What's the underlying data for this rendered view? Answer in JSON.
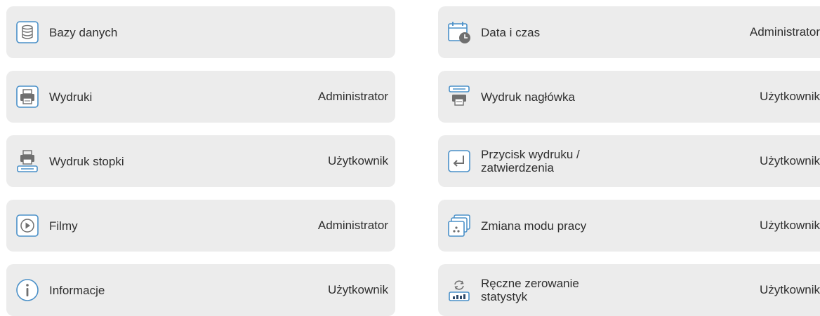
{
  "settings_menu": {
    "items": [
      {
        "label": "Bazy danych",
        "role": "",
        "icon": "database-icon"
      },
      {
        "label": "Data i czas",
        "role": "Administrator",
        "icon": "calendar-clock-icon"
      },
      {
        "label": "Wydruki",
        "role": "Administrator",
        "icon": "printer-icon"
      },
      {
        "label": "Wydruk nagłówka",
        "role": "Użytkownik",
        "icon": "header-printout-icon"
      },
      {
        "label": "Wydruk stopki",
        "role": "Użytkownik",
        "icon": "footer-printout-icon"
      },
      {
        "label": "Przycisk wydruku /\nzatwierdzenia",
        "role": "Użytkownik",
        "icon": "enter-key-icon"
      },
      {
        "label": "Filmy",
        "role": "Administrator",
        "icon": "play-circle-icon"
      },
      {
        "label": "Zmiana modu pracy",
        "role": "Użytkownik",
        "icon": "working-modes-icon"
      },
      {
        "label": "Informacje",
        "role": "Użytkownik",
        "icon": "info-icon"
      },
      {
        "label": "Ręczne zerowanie\nstatystyk",
        "role": "Użytkownik",
        "icon": "reset-statistics-icon"
      }
    ]
  },
  "colors": {
    "tile_background": "#ececec",
    "icon_blue": "#4a90c8",
    "icon_gray": "#6f6f6f",
    "text": "#2f2f2f"
  }
}
